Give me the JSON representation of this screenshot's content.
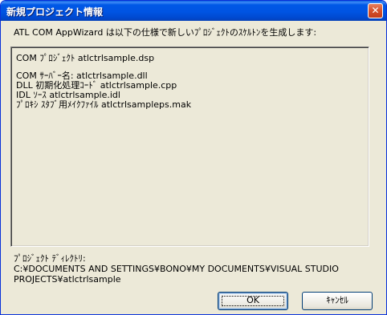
{
  "window": {
    "title": "新規プロジェクト情報",
    "close_glyph": "✕"
  },
  "intro_text": "ATL COM AppWizard は以下の仕様で新しいﾌﾟﾛｼﾞｪｸﾄのｽｹﾙﾄﾝを生成します:",
  "info_lines": [
    "COM ﾌﾟﾛｼﾞｪｸﾄ atlctrlsample.dsp",
    "COM ｻｰﾊﾞｰ名: atlctrlsample.dll",
    "DLL 初期化処理ｺｰﾄﾞ atlctrlsample.cpp",
    "IDL ｿｰｽ atlctrlsample.idl",
    "ﾌﾟﾛｷｼ ｽﾀﾌﾞ用ﾒｲｸﾌｧｲﾙ atlctrlsampleps.mak"
  ],
  "directory": {
    "label": "ﾌﾟﾛｼﾞｪｸﾄ ﾃﾞｨﾚｸﾄﾘ:",
    "path": "C:¥DOCUMENTS AND SETTINGS¥BONO¥MY DOCUMENTS¥VISUAL STUDIO PROJECTS¥atlctrlsample"
  },
  "buttons": {
    "ok": "OK",
    "cancel": "ｷｬﾝｾﾙ"
  },
  "colors": {
    "titlebar": "#0054e3",
    "dialog_bg": "#ece9d8",
    "close_button": "#d5502c"
  }
}
